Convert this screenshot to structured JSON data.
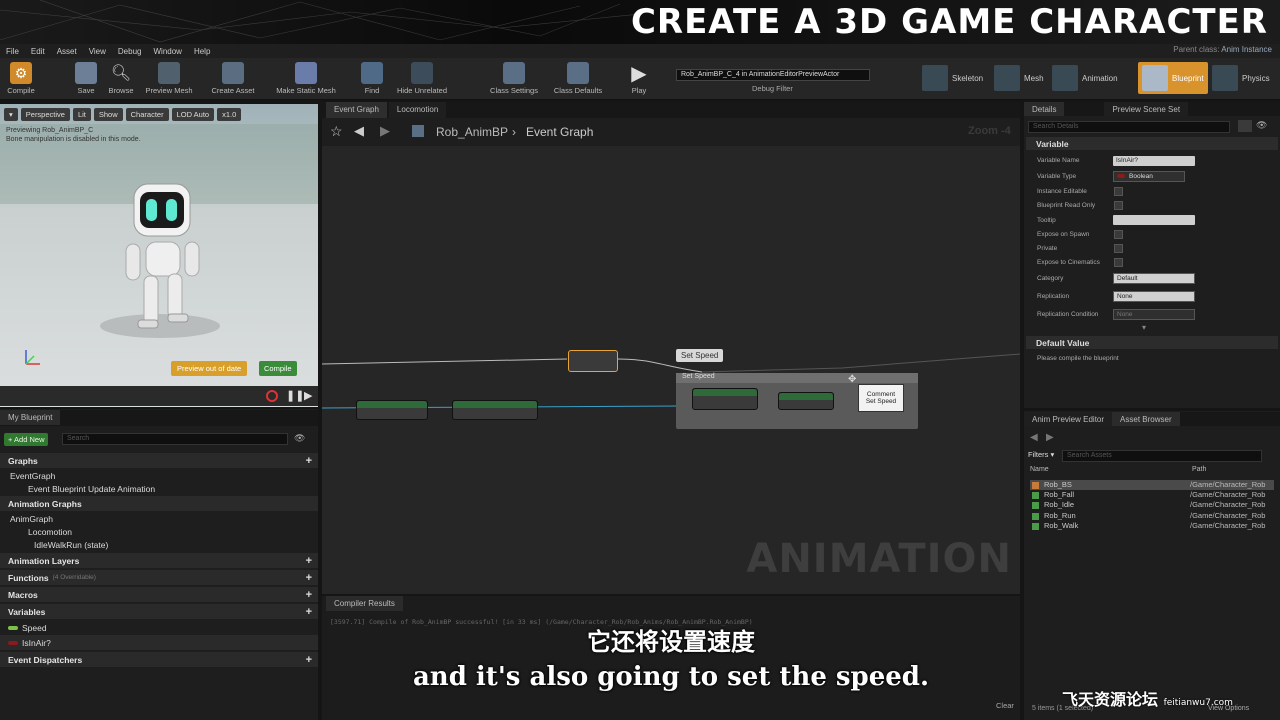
{
  "banner": {
    "title": "CREATE A 3D GAME CHARACTER"
  },
  "menu": [
    "File",
    "Edit",
    "Asset",
    "View",
    "Debug",
    "Window",
    "Help"
  ],
  "parent_class": {
    "label": "Parent class:",
    "value": "Anim Instance"
  },
  "toolbar": {
    "buttons": [
      "Compile",
      "Save",
      "Browse",
      "Preview Mesh",
      "Create Asset",
      "Make Static Mesh",
      "Find",
      "Hide Unrelated",
      "Class Settings",
      "Class Defaults",
      "Play"
    ],
    "debug_object": "Rob_AnimBP_C_4 in AnimationEditorPreviewActor",
    "debug_filter": "Debug Filter",
    "modes": [
      "Skeleton",
      "Mesh",
      "Animation",
      "Blueprint",
      "Physics"
    ]
  },
  "viewport": {
    "chips": [
      "Perspective",
      "Lit",
      "Show",
      "Character",
      "LOD Auto",
      "x1.0"
    ],
    "message_line1": "Previewing Rob_AnimBP_C",
    "message_line2": "Bone manipulation is disabled in this mode.",
    "preview_badge": "Preview out of date",
    "compile_badge": "Compile"
  },
  "my_blueprint": {
    "tab": "My Blueprint",
    "add_new": "+ Add New",
    "search_placeholder": "Search",
    "graphs_label": "Graphs",
    "event_graph": "EventGraph",
    "event_blueprint_update": "Event Blueprint Update Animation",
    "animation_graphs_label": "Animation Graphs",
    "anim_graph": "AnimGraph",
    "locomotion": "Locomotion",
    "idle_walk_run": "IdleWalkRun (state)",
    "animation_layers": "Animation Layers",
    "functions": "Functions",
    "functions_note": "(4 Overridable)",
    "macros": "Macros",
    "variables_label": "Variables",
    "var_speed": "Speed",
    "var_isinair": "IsInAir?",
    "event_dispatchers": "Event Dispatchers"
  },
  "graph": {
    "tabs": [
      "Event Graph",
      "Locomotion"
    ],
    "breadcrumb_root": "Rob_AnimBP",
    "breadcrumb_leaf": "Event Graph",
    "zoom": "Zoom -4",
    "watermark": "ANIMATION",
    "set_speed_label": "Set Speed",
    "comment_title": "Set Speed",
    "comment_tooltip": "Comment\nSet Speed"
  },
  "compiler": {
    "tab": "Compiler Results",
    "log": "[3597.71] Compile of Rob_AnimBP successful! [in 33 ms] (/Game/Character_Rob/Rob_Anims/Rob_AnimBP.Rob_AnimBP)",
    "clear": "Clear"
  },
  "subtitles": {
    "cn": "它还将设置速度",
    "en": "and it's also going to set the speed."
  },
  "details": {
    "tabs": [
      "Details",
      "Preview Scene Set"
    ],
    "search_placeholder": "Search Details",
    "variable_section": "Variable",
    "props": [
      {
        "label": "Variable Name",
        "value": "IsInAir?"
      },
      {
        "label": "Variable Type",
        "value": "Boolean"
      },
      {
        "label": "Instance Editable"
      },
      {
        "label": "Blueprint Read Only"
      },
      {
        "label": "Tooltip",
        "value": ""
      },
      {
        "label": "Expose on Spawn"
      },
      {
        "label": "Private"
      },
      {
        "label": "Expose to Cinematics"
      },
      {
        "label": "Category",
        "value": "Default"
      },
      {
        "label": "Replication",
        "value": "None"
      },
      {
        "label": "Replication Condition",
        "value": "None"
      }
    ],
    "default_value_section": "Default Value",
    "default_value_msg": "Please compile the blueprint"
  },
  "asset_browser": {
    "tabs": [
      "Anim Preview Editor",
      "Asset Browser"
    ],
    "filters": "Filters",
    "search_placeholder": "Search Assets",
    "col_name": "Name",
    "col_path": "Path",
    "rows": [
      {
        "name": "Rob_BS",
        "path": "/Game/Character_Rob"
      },
      {
        "name": "Rob_Fall",
        "path": "/Game/Character_Rob"
      },
      {
        "name": "Rob_Idle",
        "path": "/Game/Character_Rob"
      },
      {
        "name": "Rob_Run",
        "path": "/Game/Character_Rob"
      },
      {
        "name": "Rob_Walk",
        "path": "/Game/Character_Rob"
      }
    ],
    "count": "5 items (1 selected)",
    "view_options": "View Options"
  },
  "site_watermark": {
    "main": "飞天资源论坛",
    "sub": "feitianwu7.com"
  },
  "colors": {
    "accent_orange": "#e8a33a",
    "node_green": "#2f6a3a",
    "bool_red": "#8b1a1a",
    "float_green": "#7cc24a"
  }
}
